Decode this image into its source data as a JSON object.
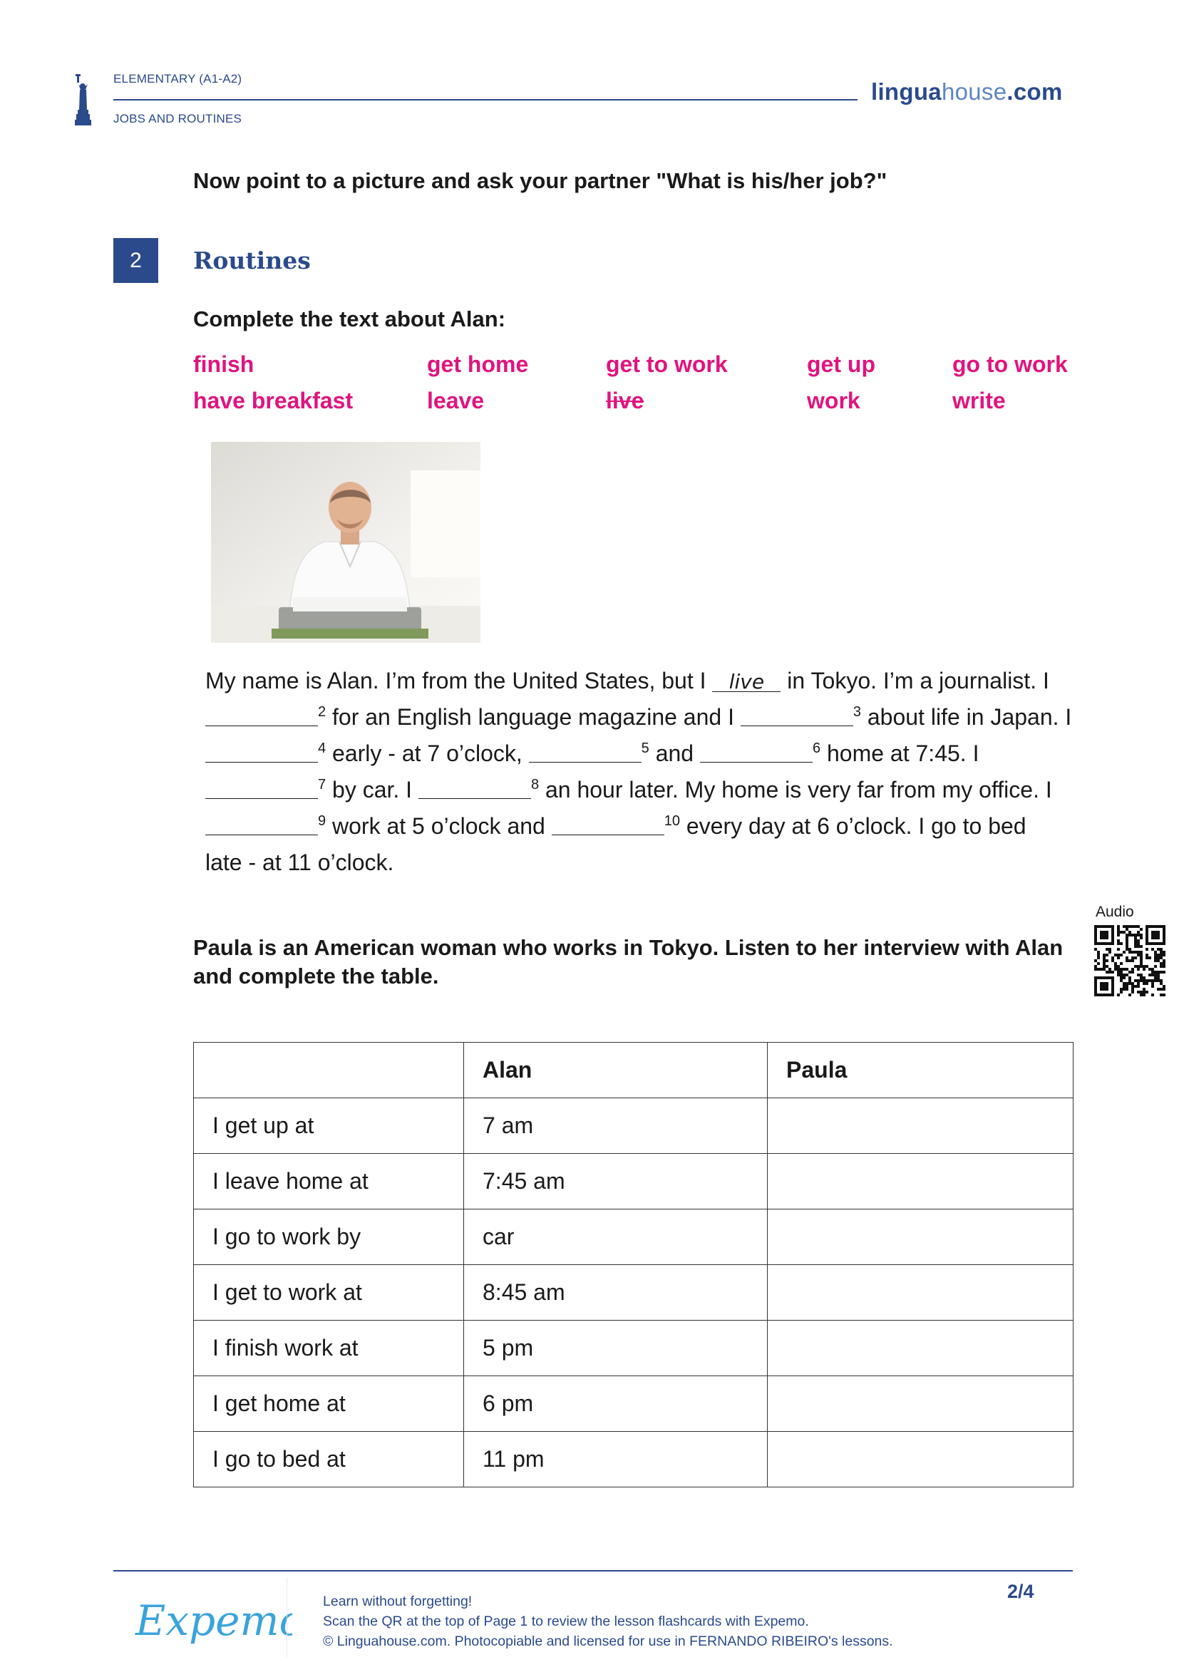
{
  "header": {
    "level": "ELEMENTARY (A1-A2)",
    "topic": "JOBS AND ROUTINES",
    "brand_bold": "lingua",
    "brand_light": "house",
    "brand_tld": ".com",
    "logo_icon": "statue-of-liberty-icon"
  },
  "intro_instruction": "Now point to a picture and ask your partner \"What is his/her job?\"",
  "section": {
    "number": "2",
    "title": "Routines"
  },
  "exercise1": {
    "instruction": "Complete the text about Alan:",
    "word_bank": [
      [
        "finish",
        "get home",
        "get to work",
        "get up",
        "go to work"
      ],
      [
        "have breakfast",
        "leave",
        "live",
        "work",
        "write"
      ]
    ],
    "struck_word": "live",
    "image": "photo of a man typing at a typewriter",
    "passage": {
      "l1a": "My name is Alan. I’m from the United States, but I ",
      "filled_answer": "live",
      "l1b": " in Tokyo. I’m a journalist. I",
      "n2": "2",
      "l2a": " for an English language magazine and I ",
      "n3": "3",
      "l2b": " about life in Japan. I",
      "n4": "4",
      "l3a": " early - at 7 o’clock, ",
      "n5": "5",
      "l3b": " and ",
      "n6": "6",
      "l3c": " home at 7:45. I",
      "n7": "7",
      "l4a": " by car. I ",
      "n8": "8",
      "l4b": " an hour later. My home is very far from my office. I",
      "n9": "9",
      "l5a": " work at 5 o’clock and ",
      "n10": "10",
      "l5b": " every day at 6 o’clock. I go to bed",
      "l6": "late - at 11 o’clock."
    }
  },
  "audio": {
    "label": "Audio",
    "icon": "qr-code-icon"
  },
  "exercise2": {
    "instruction_line1": "Paula is an American woman who works in Tokyo. Listen to her interview with Alan",
    "instruction_line2": "and complete the table.",
    "table": {
      "headers": [
        "",
        "Alan",
        "Paula"
      ],
      "rows": [
        [
          "I get up at",
          "7 am",
          ""
        ],
        [
          "I leave home at",
          "7:45 am",
          ""
        ],
        [
          "I go to work by",
          "car",
          ""
        ],
        [
          "I get to work at",
          "8:45 am",
          ""
        ],
        [
          "I finish work at",
          "5 pm",
          ""
        ],
        [
          "I get home at",
          "6 pm",
          ""
        ],
        [
          "I go to bed at",
          "11 pm",
          ""
        ]
      ]
    }
  },
  "footer": {
    "logo_text": "Expemo",
    "line1": "Learn without forgetting!",
    "line2": "Scan the QR at the top of Page 1 to review the lesson flashcards with Expemo.",
    "line3": "© Linguahouse.com. Photocopiable and licensed for use in FERNANDO RIBEIRO's lessons.",
    "page": "2/4"
  },
  "colors": {
    "brand_blue": "#2a4a8c",
    "word_bank_pink": "#e0147f",
    "expemo_blue": "#3aa3dc"
  }
}
